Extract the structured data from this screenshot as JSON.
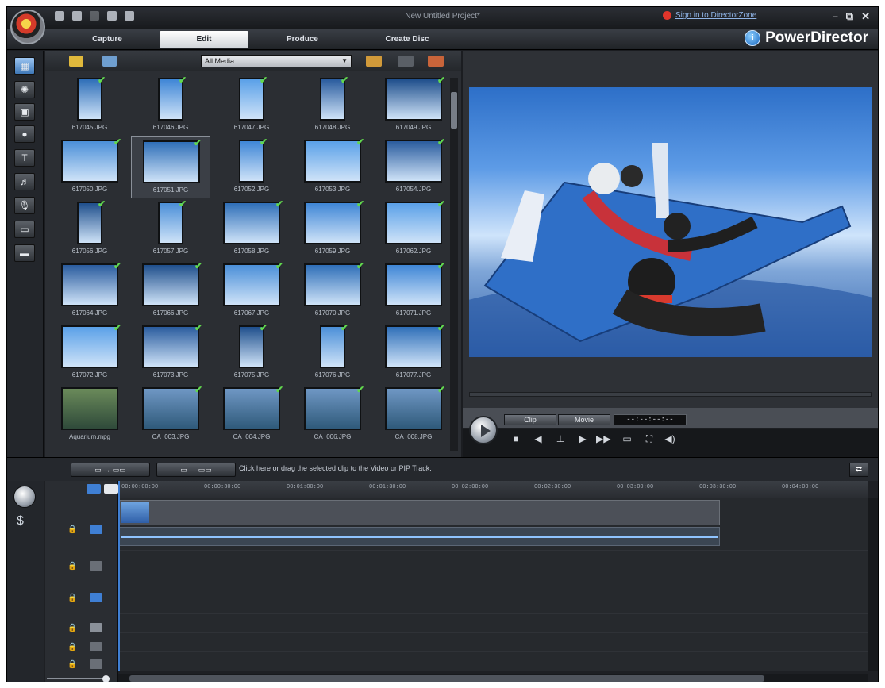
{
  "window": {
    "project_title": "New Untitled Project*",
    "signin_link": "Sign in to DirectorZone",
    "controls": [
      "–",
      "⧉",
      "✕"
    ]
  },
  "modes": {
    "tabs": [
      {
        "label": "Capture",
        "active": false
      },
      {
        "label": "Edit",
        "active": true
      },
      {
        "label": "Produce",
        "active": false
      },
      {
        "label": "Create Disc",
        "active": false
      }
    ],
    "brand": "PowerDirector"
  },
  "tools": [
    {
      "name": "media-room-icon",
      "glyph": "▦",
      "active": true
    },
    {
      "name": "effect-room-icon",
      "glyph": "✺",
      "active": false
    },
    {
      "name": "pip-room-icon",
      "glyph": "▣",
      "active": false
    },
    {
      "name": "particle-room-icon",
      "glyph": "●",
      "active": false
    },
    {
      "name": "title-room-icon",
      "glyph": "T",
      "active": false
    },
    {
      "name": "transition-room-icon",
      "glyph": "♬",
      "active": false
    },
    {
      "name": "audio-mixing-room-icon",
      "glyph": "🎙",
      "active": false
    },
    {
      "name": "voice-over-room-icon",
      "glyph": "▭",
      "active": false
    },
    {
      "name": "chapter-room-icon",
      "glyph": "▬",
      "active": false
    }
  ],
  "library": {
    "filter": "All Media",
    "items": [
      {
        "file": "617045.JPG",
        "portrait": true,
        "checked": true
      },
      {
        "file": "617046.JPG",
        "portrait": true,
        "checked": true
      },
      {
        "file": "617047.JPG",
        "portrait": true,
        "checked": true
      },
      {
        "file": "617048.JPG",
        "portrait": true,
        "checked": true
      },
      {
        "file": "617049.JPG",
        "portrait": false,
        "checked": true
      },
      {
        "file": "617050.JPG",
        "portrait": false,
        "checked": true
      },
      {
        "file": "617051.JPG",
        "portrait": false,
        "checked": true,
        "selected": true
      },
      {
        "file": "617052.JPG",
        "portrait": true,
        "checked": true
      },
      {
        "file": "617053.JPG",
        "portrait": false,
        "checked": true
      },
      {
        "file": "617054.JPG",
        "portrait": false,
        "checked": true
      },
      {
        "file": "617056.JPG",
        "portrait": true,
        "checked": true
      },
      {
        "file": "617057.JPG",
        "portrait": true,
        "checked": true
      },
      {
        "file": "617058.JPG",
        "portrait": false,
        "checked": true
      },
      {
        "file": "617059.JPG",
        "portrait": false,
        "checked": true
      },
      {
        "file": "617062.JPG",
        "portrait": false,
        "checked": true
      },
      {
        "file": "617064.JPG",
        "portrait": false,
        "checked": true
      },
      {
        "file": "617066.JPG",
        "portrait": false,
        "checked": true
      },
      {
        "file": "617067.JPG",
        "portrait": false,
        "checked": true
      },
      {
        "file": "617070.JPG",
        "portrait": false,
        "checked": true
      },
      {
        "file": "617071.JPG",
        "portrait": false,
        "checked": true
      },
      {
        "file": "617072.JPG",
        "portrait": false,
        "checked": true
      },
      {
        "file": "617073.JPG",
        "portrait": false,
        "checked": true
      },
      {
        "file": "617075.JPG",
        "portrait": true,
        "checked": true
      },
      {
        "file": "617076.JPG",
        "portrait": true,
        "checked": true
      },
      {
        "file": "617077.JPG",
        "portrait": false,
        "checked": true
      },
      {
        "file": "Aquarium.mpg",
        "portrait": false,
        "checked": false
      },
      {
        "file": "CA_003.JPG",
        "portrait": false,
        "checked": true
      },
      {
        "file": "CA_004.JPG",
        "portrait": false,
        "checked": true
      },
      {
        "file": "CA_006.JPG",
        "portrait": false,
        "checked": true
      },
      {
        "file": "CA_008.JPG",
        "portrait": false,
        "checked": true
      }
    ]
  },
  "preview": {
    "clip_label": "Clip",
    "movie_label": "Movie",
    "timecode": "--:--:--:--"
  },
  "timeline_toolbar": {
    "hint": "Click here or drag the selected clip to the Video or PIP Track."
  },
  "timeline": {
    "ruler": [
      "00:00:00:00",
      "00:00:30:00",
      "00:01:00:00",
      "00:01:30:00",
      "00:02:00:00",
      "00:02:30:00",
      "00:03:00:00",
      "00:03:30:00",
      "00:04:00:00"
    ]
  },
  "colors": {
    "accent": "#3f7fd4",
    "check": "#62d84e"
  }
}
